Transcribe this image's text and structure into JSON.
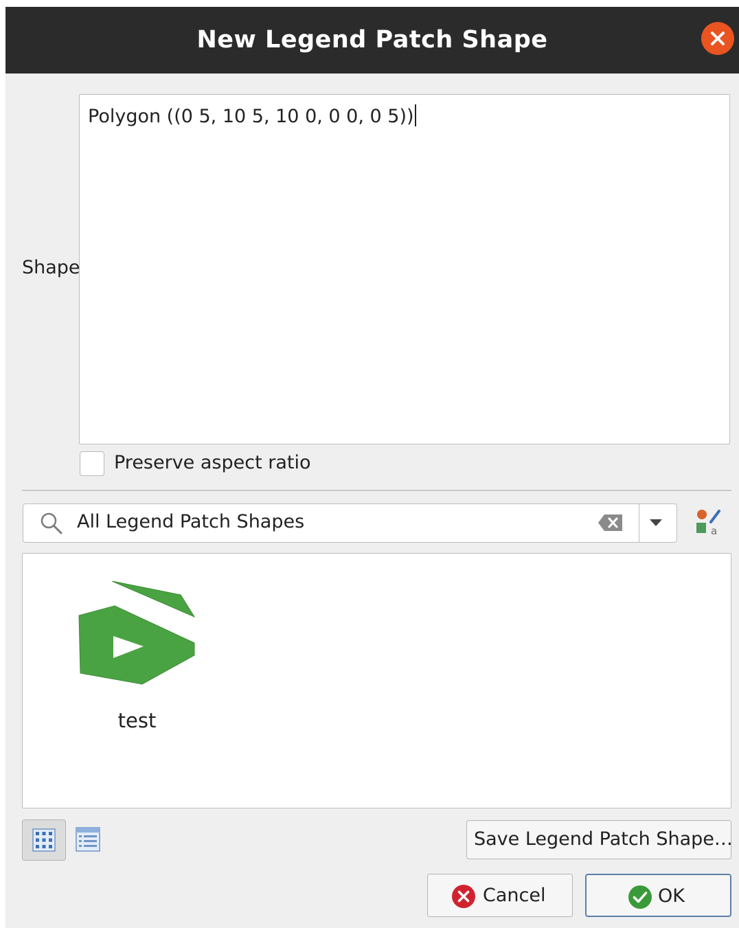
{
  "dialog": {
    "title": "New Legend Patch Shape",
    "close_icon": "close-icon"
  },
  "shape": {
    "label": "Shape",
    "value": "Polygon ((0 5, 10 5, 10 0, 0 0, 0 5))"
  },
  "preserve_aspect_ratio": {
    "label": "Preserve aspect ratio",
    "checked": false
  },
  "search": {
    "value": "All Legend Patch Shapes",
    "icon": "search-icon",
    "clear_icon": "clear-text-icon",
    "dropdown_icon": "dropdown-arrow-icon"
  },
  "style_manager_icon": "style-manager-icon",
  "gallery": {
    "items": [
      {
        "label": "test",
        "icon": "legend-patch-shape-icon"
      }
    ]
  },
  "view_toggles": {
    "icon_view": {
      "icon": "icon-view-icon",
      "active": true
    },
    "list_view": {
      "icon": "list-view-icon",
      "active": false
    }
  },
  "buttons": {
    "save_label": "Save Legend Patch Shape…",
    "cancel_label": "Cancel",
    "ok_label": "OK"
  },
  "colors": {
    "titlebar": "#2b2b2b",
    "close": "#e95420",
    "cancel_icon": "#d0232f",
    "ok_icon": "#3a9a3a",
    "patch_green": "#4aa342"
  }
}
